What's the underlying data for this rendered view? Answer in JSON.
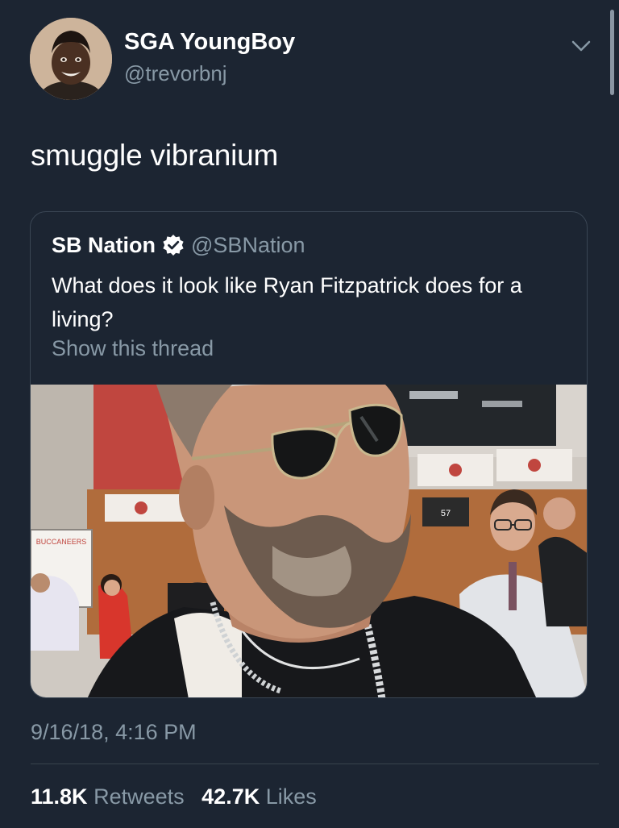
{
  "author": {
    "display_name": "SGA YoungBoy",
    "handle": "@trevorbnj",
    "avatar_icon": "profile-photo"
  },
  "tweet": {
    "text": "smuggle vibranium",
    "timestamp": "9/16/18, 4:16 PM"
  },
  "quoted_tweet": {
    "display_name": "SB Nation",
    "verified": true,
    "handle": "@SBNation",
    "text": "What does it look like Ryan Fitzpatrick does for a living?",
    "show_thread": "Show this thread",
    "media": {
      "sign_text": "BUCCANEERS",
      "locker_number": "57"
    }
  },
  "stats": {
    "retweets_count": "11.8K",
    "retweets_label": "Retweets",
    "likes_count": "42.7K",
    "likes_label": "Likes"
  },
  "colors": {
    "background": "#1c2532",
    "secondary_text": "#8899a6",
    "verified_badge": "#ffffff"
  }
}
